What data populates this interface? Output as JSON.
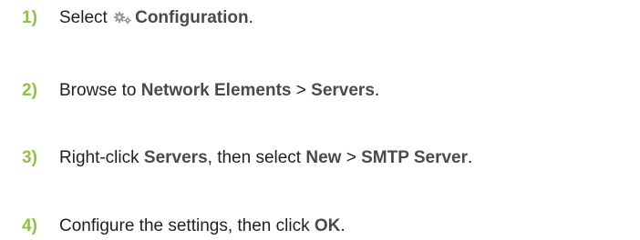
{
  "steps": [
    {
      "number": "1)",
      "parts": [
        "Select ",
        "Configuration",
        "."
      ]
    },
    {
      "number": "2)",
      "parts": [
        "Browse to ",
        "Network Elements",
        " > ",
        "Servers",
        "."
      ]
    },
    {
      "number": "3)",
      "parts": [
        "Right-click ",
        "Servers",
        ", then select ",
        "New",
        " > ",
        "SMTP Server",
        "."
      ]
    },
    {
      "number": "4)",
      "parts": [
        "Configure the settings, then click ",
        "OK",
        "."
      ]
    }
  ],
  "icons": {
    "configuration": "gear-icon"
  },
  "colors": {
    "step_number": "#8cc63f",
    "ui_term": "#4a4a4a",
    "body_text": "#1f1f1f",
    "icon": "#9a9a9a"
  }
}
